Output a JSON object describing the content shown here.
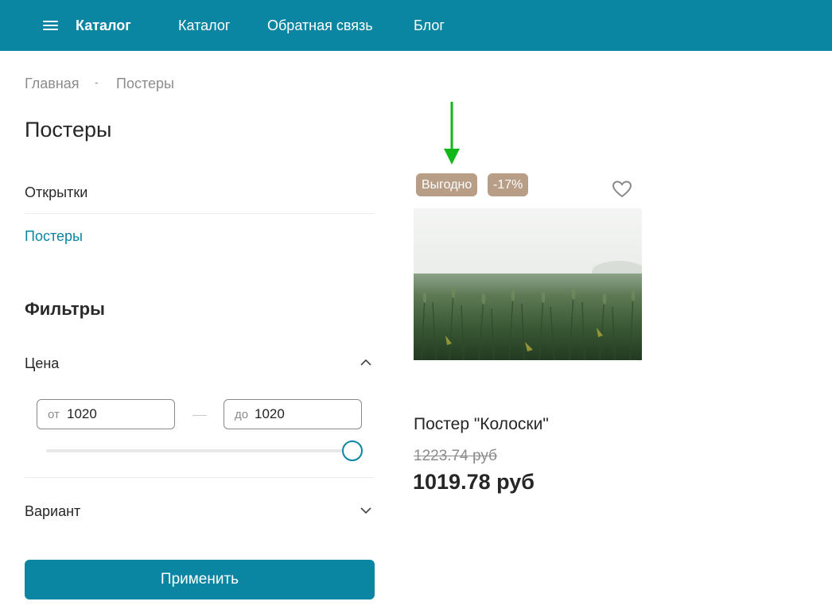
{
  "header": {
    "brand": "Каталог",
    "nav": [
      "Каталог",
      "Обратная связь",
      "Блог"
    ],
    "menu_icon": "hamburger-menu-icon",
    "background": "#0a86a2"
  },
  "breadcrumb": {
    "items": [
      "Главная",
      "Постеры"
    ],
    "separator": "-"
  },
  "page_title": "Постеры",
  "categories": [
    {
      "label": "Открытки",
      "active": false
    },
    {
      "label": "Постеры",
      "active": true
    }
  ],
  "filters": {
    "title": "Фильтры",
    "price": {
      "label": "Цена",
      "from_prefix": "от",
      "from_value": "1020",
      "to_prefix": "до",
      "to_value": "1020",
      "slider_level": 1.0
    },
    "variant": {
      "label": "Вариант"
    },
    "apply_label": "Применить"
  },
  "product": {
    "badges": [
      "Выгодно",
      "-17%"
    ],
    "name": "Постер \"Колоски\"",
    "old_price": "1223.74 руб",
    "price": "1019.78 руб",
    "favorite_icon": "heart-outline-icon"
  },
  "colors": {
    "accent": "#0a86a2",
    "badge": "#b89d87",
    "annotation_arrow": "#12b818"
  }
}
